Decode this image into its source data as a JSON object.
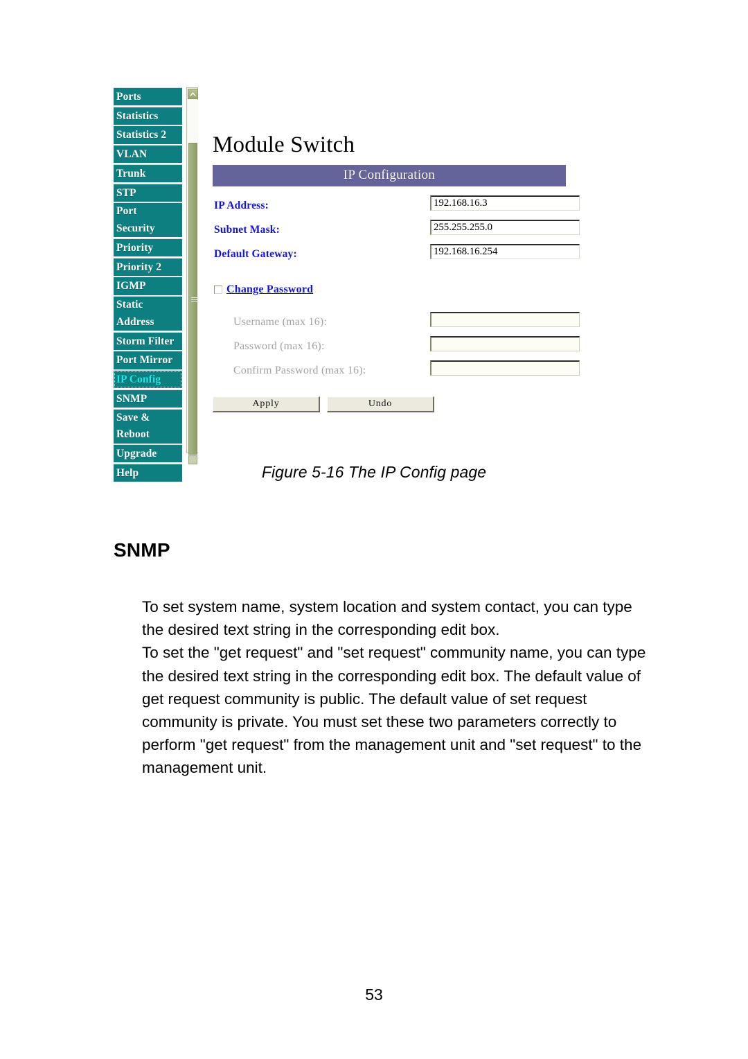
{
  "document": {
    "page_number": "53",
    "figure_caption": "Figure 5-16 The IP Config page",
    "section_heading": "SNMP",
    "paragraphs": [
      "To set system name, system location and system contact, you can type the desired text string in the corresponding edit box.",
      "To set the \"get request\" and \"set request\" community name, you can type the desired text string in the corresponding edit box. The default value of get request community is public. The default value of set request community is private. You must set these two parameters correctly to perform \"get request\" from the management unit and \"set request\" to the management unit."
    ]
  },
  "screenshot": {
    "sidebar": {
      "items": [
        {
          "label": "Ports",
          "active": false
        },
        {
          "label": "Statistics",
          "active": false
        },
        {
          "label": "Statistics 2",
          "active": false
        },
        {
          "label": "VLAN",
          "active": false
        },
        {
          "label": "Trunk",
          "active": false
        },
        {
          "label": "STP",
          "active": false
        },
        {
          "label": "Port",
          "label2": "Security",
          "active": false
        },
        {
          "label": "Priority",
          "active": false
        },
        {
          "label": "Priority 2",
          "active": false
        },
        {
          "label": "IGMP",
          "active": false
        },
        {
          "label": "Static",
          "label2": "Address",
          "active": false
        },
        {
          "label": "Storm Filter",
          "active": false
        },
        {
          "label": "Port Mirror",
          "active": false
        },
        {
          "label": "IP Config",
          "active": true
        },
        {
          "label": "SNMP",
          "active": false
        },
        {
          "label": "Save &",
          "label2": "Reboot",
          "active": false
        },
        {
          "label": "Upgrade",
          "active": false
        },
        {
          "label": "Help",
          "active": false
        }
      ]
    },
    "scrollbar": {
      "up_arrow_icon": "chevron-up-icon",
      "grip_icon": "scrollbar-grip-icon"
    },
    "panel": {
      "title": "Module Switch",
      "banner": "IP Configuration",
      "fields": [
        {
          "label": "IP Address:",
          "value": "192.168.16.3",
          "disabled": false
        },
        {
          "label": "Subnet Mask:",
          "value": "255.255.255.0",
          "disabled": false
        },
        {
          "label": "Default Gateway:",
          "value": "192.168.16.254",
          "disabled": false
        }
      ],
      "change_password": {
        "label": "Change Password",
        "checked": false
      },
      "password_fields": [
        {
          "label": "Username (max 16):",
          "value": "",
          "disabled": true
        },
        {
          "label": "Password (max 16):",
          "value": "",
          "disabled": true
        },
        {
          "label": "Confirm Password (max 16):",
          "value": "",
          "disabled": true
        }
      ],
      "buttons": {
        "apply": "Apply",
        "undo": "Undo"
      }
    },
    "colors": {
      "nav_background": "#0d7f80",
      "nav_active_text": "#22e8e8",
      "banner_background": "#65649a",
      "label_blue": "#1515d8",
      "scrollbar_thumb": "#9aa974",
      "button_face": "#eceade"
    }
  }
}
